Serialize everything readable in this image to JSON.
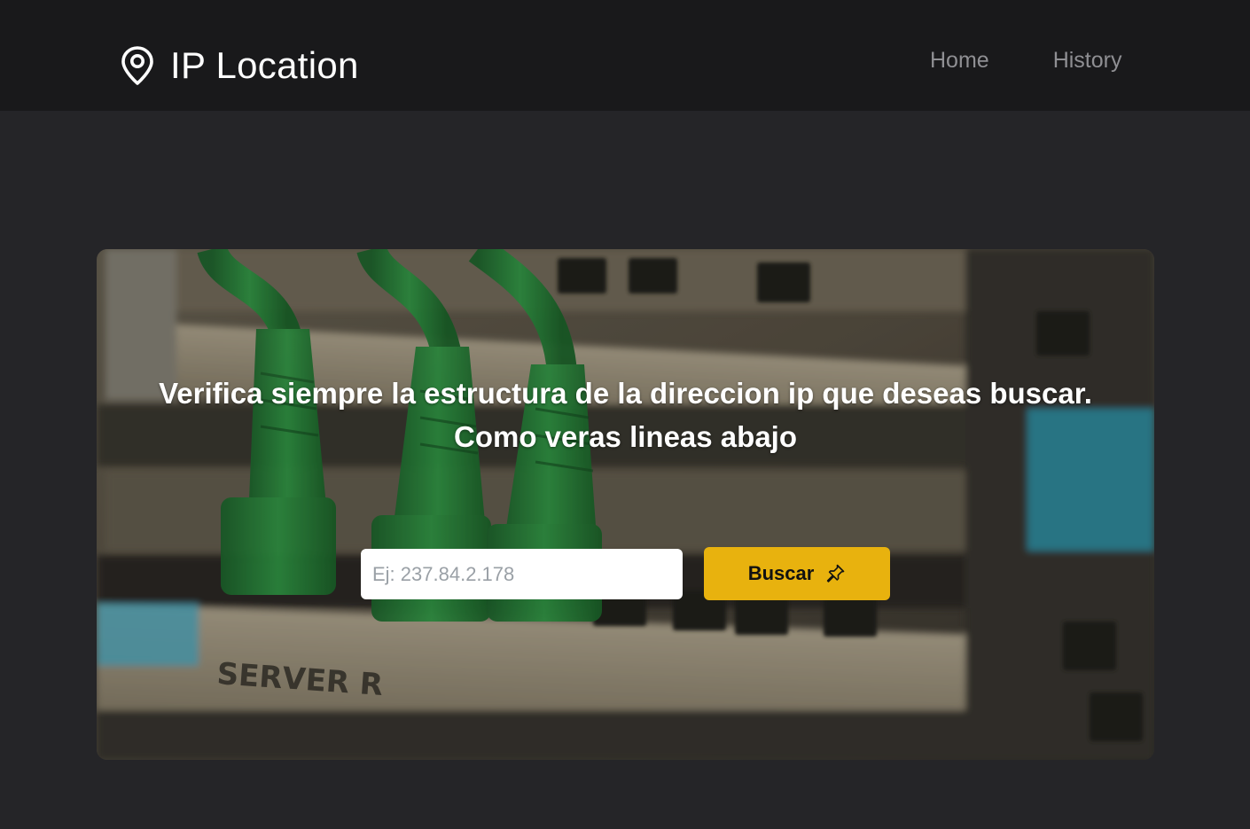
{
  "header": {
    "brand_icon": "location-pin-icon",
    "title": "IP Location",
    "nav": [
      {
        "label": "Home"
      },
      {
        "label": "History"
      }
    ]
  },
  "hero": {
    "message_line1": "Verifica siempre la estructura de la direccion ip que deseas buscar.",
    "message_line2": "Como veras lineas abajo",
    "background_image": "green-network-cables-server-rack-photo",
    "search": {
      "placeholder": "Ej: 237.84.2.178",
      "value": "",
      "button_label": "Buscar",
      "button_icon": "pushpin-icon"
    }
  },
  "colors": {
    "page_bg": "#252528",
    "navbar_bg": "#19191b",
    "accent": "#e8b20e",
    "nav_link": "#8f8f93"
  }
}
